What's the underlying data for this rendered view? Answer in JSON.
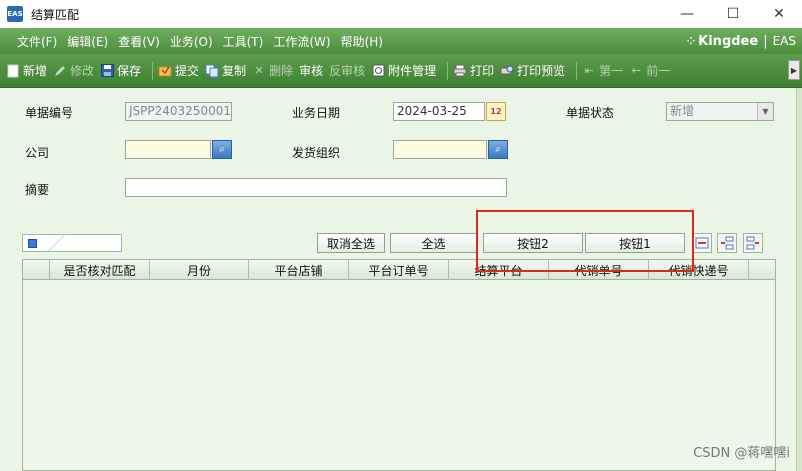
{
  "window": {
    "title": "结算匹配",
    "app_icon": "EAS",
    "minimize": "—",
    "maximize": "☐",
    "close": "✕"
  },
  "menu": {
    "items": [
      "文件(F)",
      "编辑(E)",
      "查看(V)",
      "业务(O)",
      "工具(T)",
      "工作流(W)",
      "帮助(H)"
    ],
    "brand": "Kingdee",
    "product": "EAS"
  },
  "toolbar": {
    "new": "新增",
    "edit": "修改",
    "save": "保存",
    "submit": "提交",
    "copy": "复制",
    "delete": "删除",
    "audit": "审核",
    "unaudit": "反审核",
    "attachment": "附件管理",
    "print": "打印",
    "print_preview": "打印预览",
    "first": "第一",
    "prev": "前一"
  },
  "form": {
    "bill_no_label": "单据编号",
    "bill_no_value": "JSPP2403250001",
    "biz_date_label": "业务日期",
    "biz_date_value": "2024-03-25",
    "bill_status_label": "单据状态",
    "bill_status_value": "新增",
    "company_label": "公司",
    "company_value": "",
    "ship_org_label": "发货组织",
    "ship_org_value": "",
    "summary_label": "摘要",
    "summary_value": ""
  },
  "grid_toolbar": {
    "deselect_all": "取消全选",
    "select_all": "全选",
    "button2": "按钮2",
    "button1": "按钮1"
  },
  "table": {
    "columns": [
      "是否核对匹配",
      "月份",
      "平台店铺",
      "平台订单号",
      "结算平台",
      "代销单号",
      "代销快递号"
    ]
  },
  "watermark": "CSDN @蒋嘿嘿i",
  "colors": {
    "menu_green": "#4d8d3e",
    "form_bg": "#eaf5e6",
    "highlight_red": "#e0251b"
  }
}
